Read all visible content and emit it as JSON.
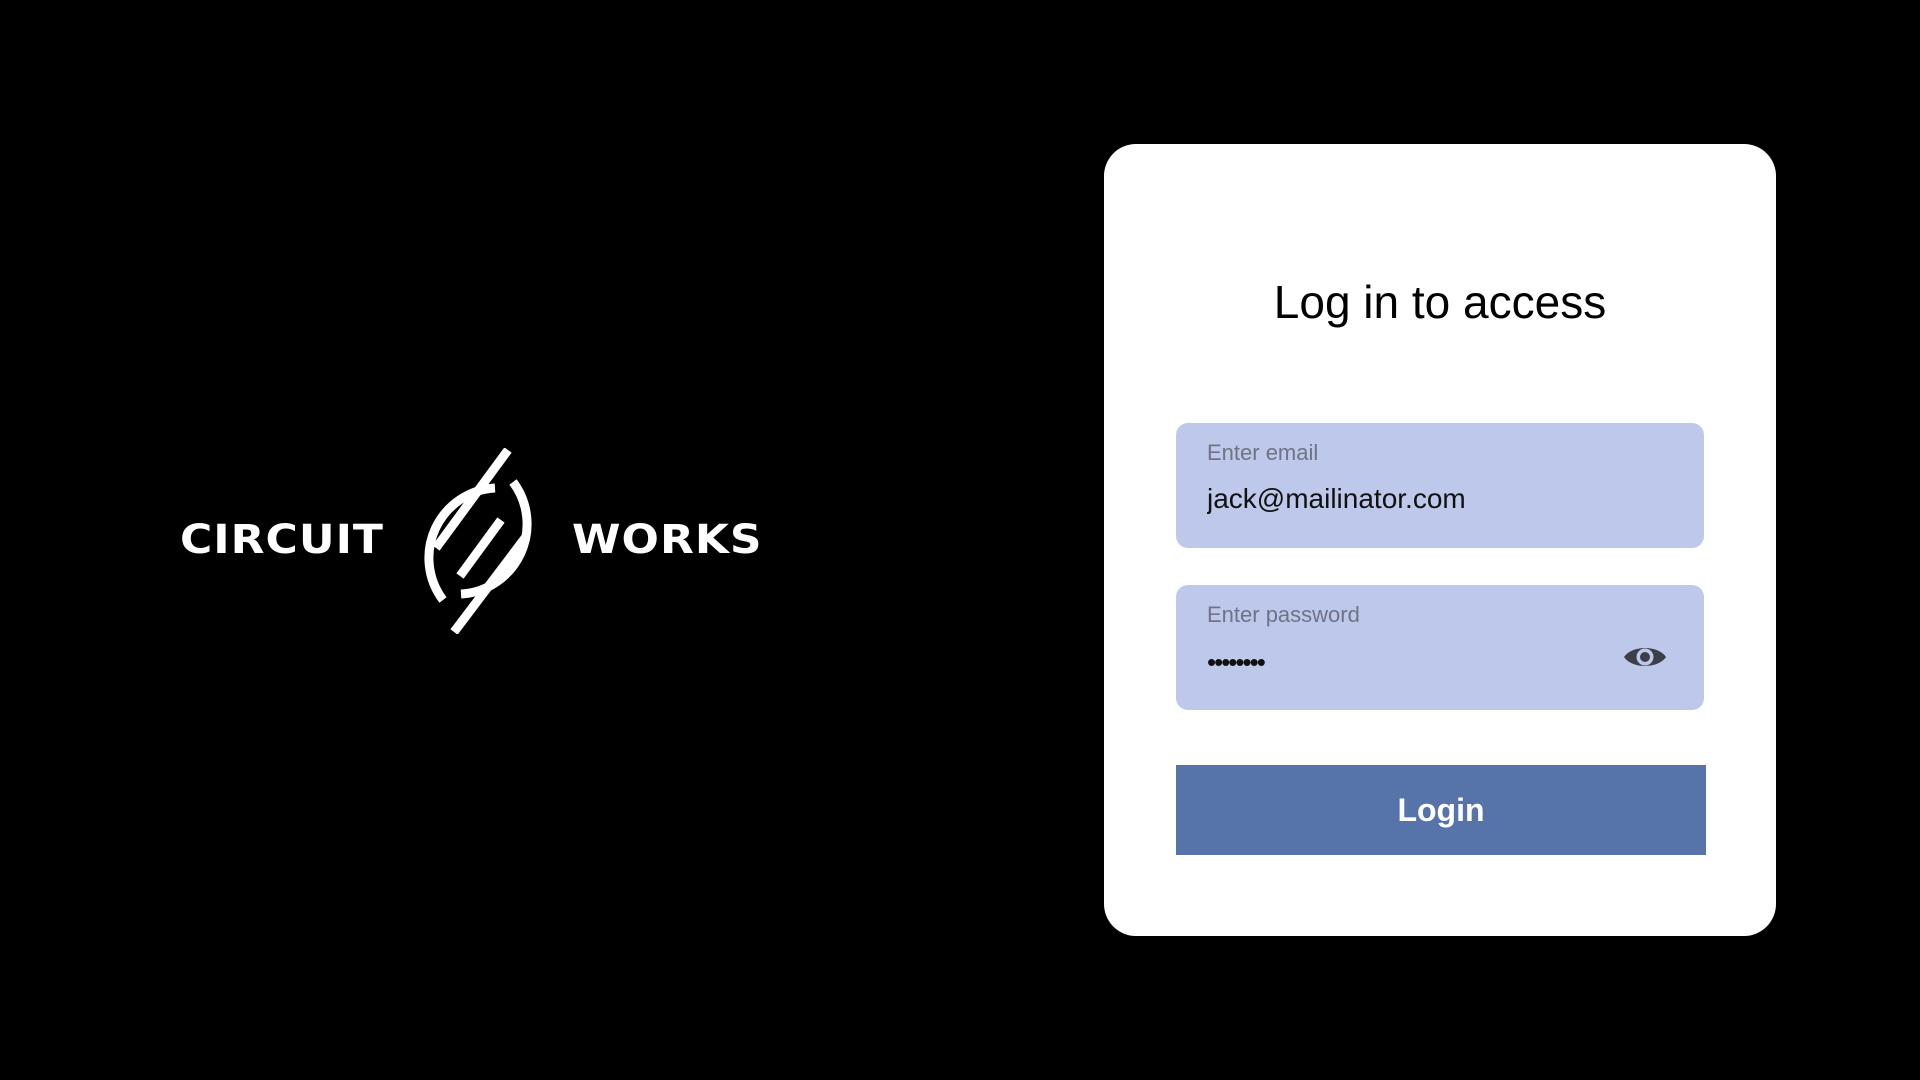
{
  "brand": {
    "word_left": "CIRCUIT",
    "word_right": "WORKS",
    "logo_icon": "circuit-works-emblem"
  },
  "login": {
    "title": "Log in to access",
    "email": {
      "label": "Enter email",
      "value": "jack@mailinator.com"
    },
    "password": {
      "label": "Enter password",
      "masked_value": "••••••••",
      "toggle_icon": "eye-icon"
    },
    "submit_label": "Login"
  },
  "colors": {
    "background": "#000000",
    "card": "#ffffff",
    "field": "#bec8ea",
    "button": "#5673aa",
    "button_text": "#ffffff"
  }
}
